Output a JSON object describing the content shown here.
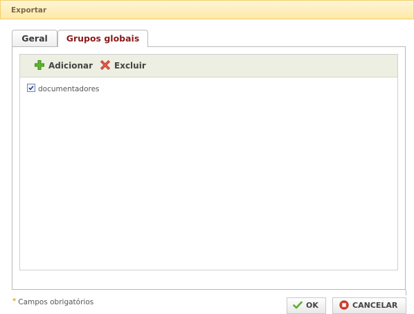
{
  "dialog": {
    "title": "Exportar"
  },
  "tabs": [
    {
      "label": "Geral",
      "active": false
    },
    {
      "label": "Grupos globais",
      "active": true
    }
  ],
  "toolbar": {
    "add_label": "Adicionar",
    "delete_label": "Excluir"
  },
  "groups": [
    {
      "label": "documentadores",
      "checked": true
    }
  ],
  "footer": {
    "required_marker": "*",
    "required_note": "Campos obrigatórios",
    "ok_label": "OK",
    "cancel_label": "CANCELAR"
  },
  "colors": {
    "title_bg": "#fde9a8",
    "active_tab_text": "#8b1a1a",
    "toolbar_bg": "#ecefe1",
    "add_icon": "#5cb82e",
    "delete_icon": "#e25a4a",
    "cancel_icon": "#d9412e",
    "ok_icon": "#58ad2f"
  },
  "icons": {
    "add": "plus-icon",
    "delete": "x-icon",
    "ok": "check-icon",
    "cancel": "stop-icon"
  }
}
